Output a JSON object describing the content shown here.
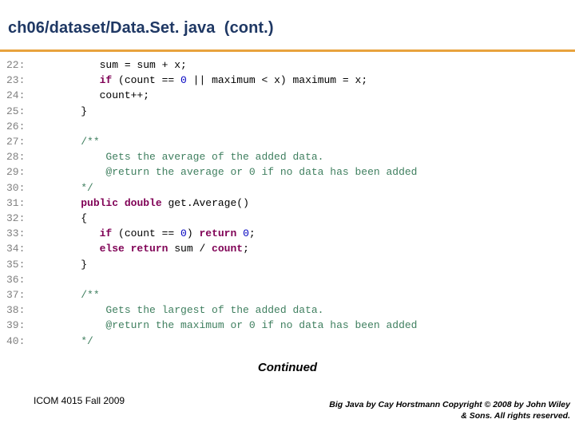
{
  "slide": {
    "title": "ch06/dataset/Data.Set. java  (cont.)",
    "accent_color": "#e8a33d",
    "title_color": "#1f3864",
    "continued_label": "Continued",
    "footer_left": "ICOM 4015 Fall 2009",
    "footer_right_line1": "Big Java by Cay Horstmann Copyright © 2008 by John Wiley",
    "footer_right_line2": "& Sons.  All rights reserved."
  },
  "code": {
    "lines": [
      {
        "num": "22:",
        "segments": [
          {
            "t": "       sum = sum + x;",
            "c": "pl"
          }
        ]
      },
      {
        "num": "23:",
        "segments": [
          {
            "t": "       ",
            "c": "pl"
          },
          {
            "t": "if",
            "c": "kw"
          },
          {
            "t": " (count == ",
            "c": "pl"
          },
          {
            "t": "0",
            "c": "nm"
          },
          {
            "t": " || maximum ",
            "c": "pl"
          },
          {
            "t": "<",
            "c": "pl"
          },
          {
            "t": " x) maximum = x;",
            "c": "pl"
          }
        ]
      },
      {
        "num": "24:",
        "segments": [
          {
            "t": "       count++;",
            "c": "pl"
          }
        ]
      },
      {
        "num": "25:",
        "segments": [
          {
            "t": "    }",
            "c": "pl"
          }
        ]
      },
      {
        "num": "26:",
        "segments": [
          {
            "t": "",
            "c": "pl"
          }
        ]
      },
      {
        "num": "27:",
        "segments": [
          {
            "t": "    ",
            "c": "pl"
          },
          {
            "t": "/**",
            "c": "cm"
          }
        ]
      },
      {
        "num": "28:",
        "segments": [
          {
            "t": "        ",
            "c": "pl"
          },
          {
            "t": "Gets the average of the added data.",
            "c": "cm"
          }
        ]
      },
      {
        "num": "29:",
        "segments": [
          {
            "t": "        ",
            "c": "pl"
          },
          {
            "t": "@return the average or 0 if no data has been added",
            "c": "cm"
          }
        ]
      },
      {
        "num": "30:",
        "segments": [
          {
            "t": "    ",
            "c": "pl"
          },
          {
            "t": "*/",
            "c": "cm"
          }
        ]
      },
      {
        "num": "31:",
        "segments": [
          {
            "t": "    ",
            "c": "pl"
          },
          {
            "t": "public",
            "c": "kw"
          },
          {
            "t": " ",
            "c": "pl"
          },
          {
            "t": "double",
            "c": "kw"
          },
          {
            "t": " get.Average()",
            "c": "pl"
          }
        ]
      },
      {
        "num": "32:",
        "segments": [
          {
            "t": "    {",
            "c": "pl"
          }
        ]
      },
      {
        "num": "33:",
        "segments": [
          {
            "t": "       ",
            "c": "pl"
          },
          {
            "t": "if",
            "c": "kw"
          },
          {
            "t": " (count == ",
            "c": "pl"
          },
          {
            "t": "0",
            "c": "nm"
          },
          {
            "t": ") ",
            "c": "pl"
          },
          {
            "t": "return",
            "c": "kw"
          },
          {
            "t": " ",
            "c": "pl"
          },
          {
            "t": "0",
            "c": "nm"
          },
          {
            "t": ";",
            "c": "pl"
          }
        ]
      },
      {
        "num": "34:",
        "segments": [
          {
            "t": "       ",
            "c": "pl"
          },
          {
            "t": "else return",
            "c": "kw"
          },
          {
            "t": " sum / ",
            "c": "pl"
          },
          {
            "t": "count",
            "c": "kw"
          },
          {
            "t": ";",
            "c": "pl"
          }
        ]
      },
      {
        "num": "35:",
        "segments": [
          {
            "t": "    }",
            "c": "pl"
          }
        ]
      },
      {
        "num": "36:",
        "segments": [
          {
            "t": "",
            "c": "pl"
          }
        ]
      },
      {
        "num": "37:",
        "segments": [
          {
            "t": "    ",
            "c": "pl"
          },
          {
            "t": "/**",
            "c": "cm"
          }
        ]
      },
      {
        "num": "38:",
        "segments": [
          {
            "t": "        ",
            "c": "pl"
          },
          {
            "t": "Gets the largest of the added data.",
            "c": "cm"
          }
        ]
      },
      {
        "num": "39:",
        "segments": [
          {
            "t": "        ",
            "c": "pl"
          },
          {
            "t": "@return the maximum or 0 if no data has been added",
            "c": "cm"
          }
        ]
      },
      {
        "num": "40:",
        "segments": [
          {
            "t": "    ",
            "c": "pl"
          },
          {
            "t": "*/",
            "c": "cm"
          }
        ]
      }
    ]
  }
}
